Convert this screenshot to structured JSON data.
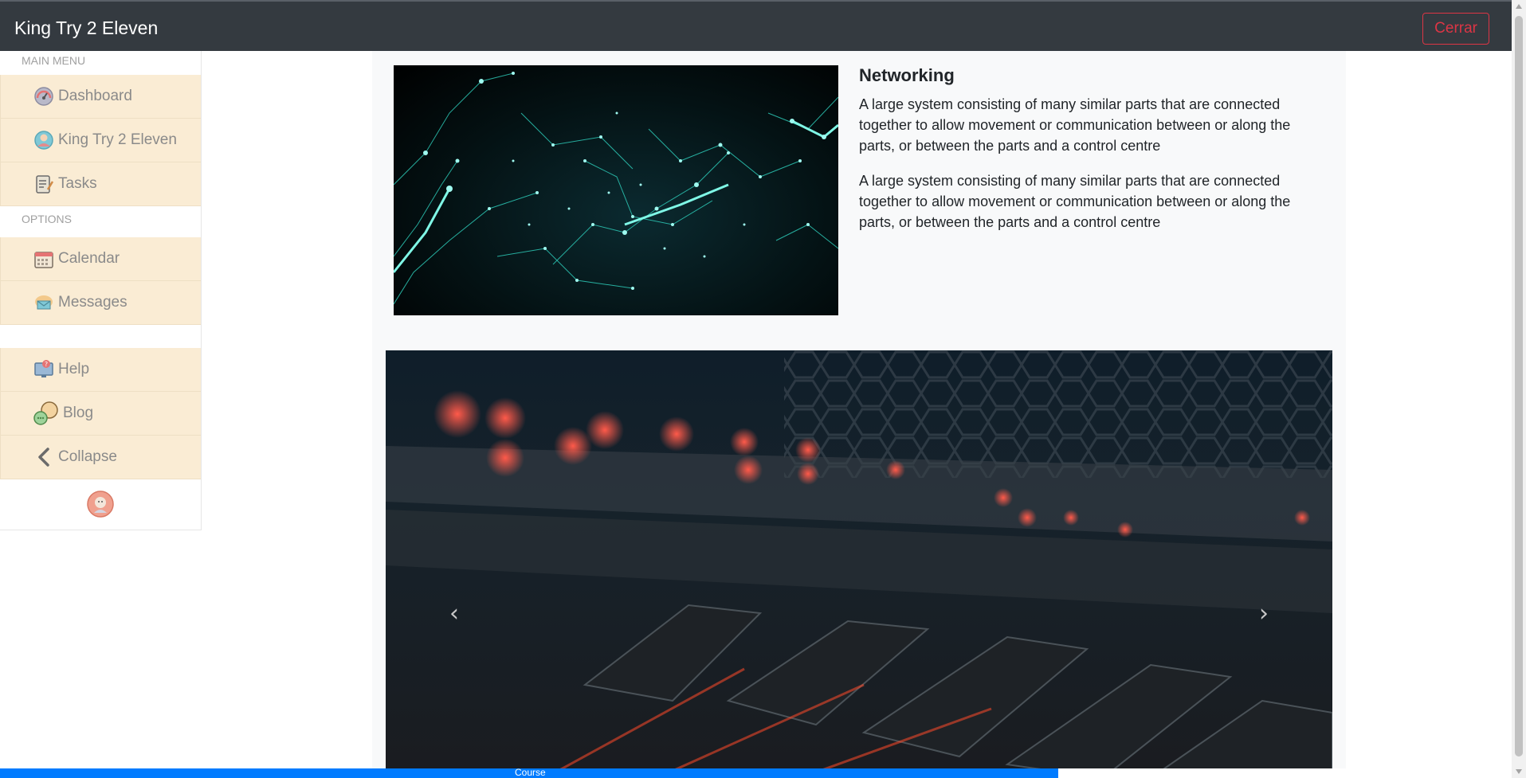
{
  "header": {
    "title": "King Try 2 Eleven",
    "close_label": "Cerrar"
  },
  "sidebar": {
    "main_menu_label": "MAIN MENU",
    "main_items": [
      {
        "label": "Dashboard",
        "icon": "dashboard-icon"
      },
      {
        "label": "King Try 2 Eleven",
        "icon": "user-avatar-icon"
      },
      {
        "label": "Tasks",
        "icon": "clipboard-icon"
      }
    ],
    "options_label": "OPTIONS",
    "option_items": [
      {
        "label": "Calendar",
        "icon": "calendar-icon"
      },
      {
        "label": "Messages",
        "icon": "mail-icon"
      }
    ],
    "extra_items": [
      {
        "label": "Help",
        "icon": "help-monitor-icon"
      },
      {
        "label": "Blog",
        "icon": "chat-bubbles-icon"
      },
      {
        "label": "Collapse",
        "icon": "chevron-left-icon"
      }
    ],
    "footer_icon": "user-avatar-icon"
  },
  "main": {
    "section_title": "Networking",
    "paragraphs": [
      "A large system consisting of many similar parts that are connected together to allow movement or communication between or along the parts, or between the parts and a control centre",
      "A large system consisting of many similar parts that are connected together to allow movement or communication between or along the parts, or between the parts and a control centre"
    ],
    "carousel": {
      "prev_icon": "chevron-left-icon",
      "next_icon": "chevron-right-icon"
    }
  },
  "progress": {
    "label": "Course",
    "fraction": 0.7,
    "color": "#007bff"
  },
  "colors": {
    "topbar": "#343a40",
    "sidebar_item_bg": "#faecd4",
    "danger": "#dc3545",
    "accent": "#007bff"
  }
}
